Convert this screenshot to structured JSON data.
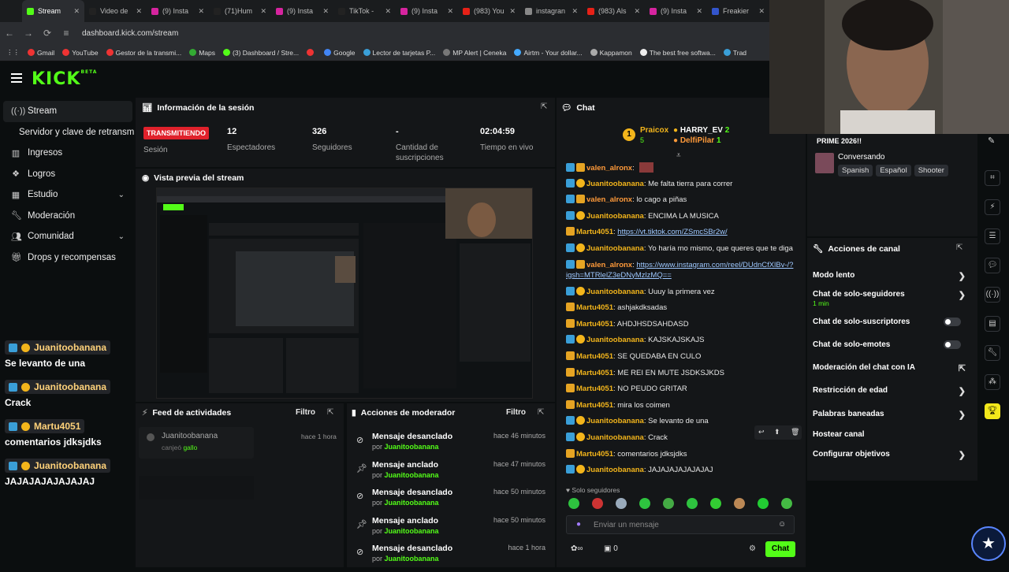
{
  "browser": {
    "tabs": [
      {
        "label": "Stream",
        "color": "#53fc18",
        "active": true
      },
      {
        "label": "Video de",
        "color": "#222"
      },
      {
        "label": "(9) Insta",
        "color": "#d6249f"
      },
      {
        "label": "(71)Hum",
        "color": "#222"
      },
      {
        "label": "(9) Insta",
        "color": "#d6249f"
      },
      {
        "label": "TikTok -",
        "color": "#222"
      },
      {
        "label": "(9) Insta",
        "color": "#d6249f"
      },
      {
        "label": "(983) You",
        "color": "#e62117"
      },
      {
        "label": "instagran",
        "color": "#888"
      },
      {
        "label": "(983) Als",
        "color": "#e62117"
      },
      {
        "label": "(9) Insta",
        "color": "#d6249f"
      },
      {
        "label": "Freakier",
        "color": "#3355cc"
      }
    ],
    "url": "dashboard.kick.com/stream",
    "bookmarks": [
      {
        "label": "Gmail",
        "color": "#e33"
      },
      {
        "label": "YouTube",
        "color": "#e33"
      },
      {
        "label": "Gestor de la transmi...",
        "color": "#e33"
      },
      {
        "label": "Maps",
        "color": "#3a3"
      },
      {
        "label": "(3) Dashboard / Stre...",
        "color": "#53fc18"
      },
      {
        "label": "",
        "color": "#e33"
      },
      {
        "label": "Google",
        "color": "#4285f4"
      },
      {
        "label": "Lector de tarjetas P...",
        "color": "#3a9fd8"
      },
      {
        "label": "MP Alert | Ceneka",
        "color": "#777"
      },
      {
        "label": "Airtm - Your dollar...",
        "color": "#4af"
      },
      {
        "label": "Kappamon",
        "color": "#aaa"
      },
      {
        "label": "The best free softwa...",
        "color": "#eee"
      },
      {
        "label": "Trad",
        "color": "#3a9fd8"
      }
    ]
  },
  "kick": {
    "logo": "KICK",
    "beta": "BETA"
  },
  "sidebar": {
    "items": [
      {
        "label": "Stream",
        "icon": "stream-icon",
        "sel": true
      },
      {
        "label": "Servidor y clave de retransm",
        "sub": true
      },
      {
        "label": "Ingresos",
        "icon": "chart-icon"
      },
      {
        "label": "Logros",
        "icon": "award-icon"
      },
      {
        "label": "Estudio",
        "icon": "layout-icon",
        "chev": true
      },
      {
        "label": "Moderación",
        "icon": "wrench-icon"
      },
      {
        "label": "Comunidad",
        "icon": "people-icon",
        "chev": true
      },
      {
        "label": "Drops y recompensas",
        "icon": "gift-icon"
      }
    ]
  },
  "overlay": [
    {
      "name": "Juanitoobanana",
      "msg": "Se levanto de una"
    },
    {
      "name": "Juanitoobanana",
      "msg": "Crack"
    },
    {
      "name": "Martu4051",
      "msg": "comentarios jdksjdks"
    },
    {
      "name": "Juanitoobanana",
      "msg": "JAJAJAJAJAJAJAJ"
    }
  ],
  "session": {
    "title": "Información de la sesión",
    "status": "TRANSMITIENDO",
    "status_label": "Sesión",
    "stats": [
      {
        "value": "12",
        "label": "Espectadores"
      },
      {
        "value": "326",
        "label": "Seguidores"
      },
      {
        "value": "-",
        "label": "Cantidad de suscripciones"
      },
      {
        "value": "02:04:59",
        "label": "Tiempo en vivo"
      }
    ]
  },
  "preview": {
    "title": "Vista previa del stream"
  },
  "activity": {
    "title": "Feed de actividades",
    "filter": "Filtro",
    "user": "Juanitoobanana",
    "action": "canjeó",
    "item": "gallo",
    "time": "hace 1 hora"
  },
  "modactions": {
    "title": "Acciones de moderador",
    "filter": "Filtro",
    "prefix": "por",
    "rows": [
      {
        "title": "Mensaje desanclado",
        "by": "Juanitoobanana",
        "time": "hace 46 minutos",
        "icon": "unpin-icon"
      },
      {
        "title": "Mensaje anclado",
        "by": "Juanitoobanana",
        "time": "hace 47 minutos",
        "icon": "pin-icon"
      },
      {
        "title": "Mensaje desanclado",
        "by": "Juanitoobanana",
        "time": "hace 50 minutos",
        "icon": "unpin-icon"
      },
      {
        "title": "Mensaje anclado",
        "by": "Juanitoobanana",
        "time": "hace 50 minutos",
        "icon": "pin-icon"
      },
      {
        "title": "Mensaje desanclado",
        "by": "Juanitoobanana",
        "time": "hace 1 hora",
        "icon": "unpin-icon"
      }
    ]
  },
  "chat": {
    "title": "Chat",
    "leaderboard": {
      "gift_count": "5",
      "user1": "Praicox",
      "user2": "HARRY_EV",
      "user2_count": "2",
      "user3": "DelfiPilar",
      "user3_count": "1"
    },
    "messages": [
      {
        "user": "valen_alronx",
        "text": "",
        "color": "#ff9a3a",
        "badges": [
          "b-blue",
          "b-crown"
        ],
        "emote": true
      },
      {
        "user": "Juanitoobanana",
        "text": "Me falta tierra para correr",
        "color": "#f3b51b",
        "badges": [
          "b-blue",
          "b-gold"
        ]
      },
      {
        "user": "valen_alronx",
        "text": "lo cago a piñas",
        "color": "#ff9a3a",
        "badges": [
          "b-blue",
          "b-crown"
        ]
      },
      {
        "user": "Juanitoobanana",
        "text": "ENCIMA LA MUSICA",
        "color": "#f3b51b",
        "badges": [
          "b-blue",
          "b-gold"
        ]
      },
      {
        "user": "Martu4051",
        "text": "",
        "link": "https://vt.tiktok.com/ZSmcSBr2w/",
        "color": "#f3b51b",
        "badges": [
          "b-crown"
        ]
      },
      {
        "user": "Juanitoobanana",
        "text": "Yo haría mo mismo, que queres que te diga",
        "color": "#f3b51b",
        "badges": [
          "b-blue",
          "b-gold"
        ]
      },
      {
        "user": "valen_alronx",
        "text": "",
        "link": "https://www.instagram.com/reel/DUdnCfXlBv-/?igsh=MTRlelZ3eDNyMzlzMQ==",
        "color": "#ff9a3a",
        "badges": [
          "b-blue",
          "b-crown"
        ],
        "two": true
      },
      {
        "user": "Juanitoobanana",
        "text": "Uuuy la primera vez",
        "color": "#f3b51b",
        "badges": [
          "b-blue",
          "b-gold"
        ]
      },
      {
        "user": "Martu4051",
        "text": "ashjakdksadas",
        "color": "#f3b51b",
        "badges": [
          "b-crown"
        ]
      },
      {
        "user": "Martu4051",
        "text": "AHDJHSDSAHDASD",
        "color": "#f3b51b",
        "badges": [
          "b-crown"
        ]
      },
      {
        "user": "Juanitoobanana",
        "text": "KAJSKAJSKAJS",
        "color": "#f3b51b",
        "badges": [
          "b-blue",
          "b-gold"
        ]
      },
      {
        "user": "Martu4051",
        "text": "SE QUEDABA EN CULO",
        "color": "#f3b51b",
        "badges": [
          "b-crown"
        ]
      },
      {
        "user": "Martu4051",
        "text": "ME REI EN MUTE JSDKSJKDS",
        "color": "#f3b51b",
        "badges": [
          "b-crown"
        ]
      },
      {
        "user": "Martu4051",
        "text": "NO PEUDO GRITAR",
        "color": "#f3b51b",
        "badges": [
          "b-crown"
        ]
      },
      {
        "user": "Martu4051",
        "text": "mira los coimen",
        "color": "#f3b51b",
        "badges": [
          "b-crown"
        ]
      },
      {
        "user": "Juanitoobanana",
        "text": "Se levanto de una",
        "color": "#f3b51b",
        "badges": [
          "b-blue",
          "b-gold"
        ]
      },
      {
        "user": "Juanitoobanana",
        "text": "Crack",
        "color": "#f3b51b",
        "badges": [
          "b-blue",
          "b-gold"
        ]
      },
      {
        "user": "Martu4051",
        "text": "comentarios jdksjdks",
        "color": "#f3b51b",
        "badges": [
          "b-crown"
        ]
      },
      {
        "user": "Juanitoobanana",
        "text": "JAJAJAJAJAJAJAJ",
        "color": "#f3b51b",
        "badges": [
          "b-blue",
          "b-gold"
        ]
      }
    ],
    "followers_only": "Solo seguidores",
    "placeholder": "Enviar un mensaje",
    "points": "0",
    "send": "Chat"
  },
  "streaminfo": {
    "title_partial": "PRIME 2026!!",
    "category": "Conversando",
    "tags": [
      "Spanish",
      "Español",
      "Shooter"
    ]
  },
  "channel_actions": {
    "title": "Acciones de canal",
    "items": [
      {
        "label": "Modo lento",
        "control": "chev"
      },
      {
        "label": "Chat de solo-seguidores",
        "sub": "1 min",
        "control": "chev"
      },
      {
        "label": "Chat de solo-suscriptores",
        "control": "toggle"
      },
      {
        "label": "Chat de solo-emotes",
        "control": "toggle"
      },
      {
        "label": "Moderación del chat con IA",
        "control": "ext"
      },
      {
        "label": "Restricción de edad",
        "control": "chev"
      },
      {
        "label": "Palabras baneadas",
        "control": "chev"
      },
      {
        "label": "Hostear canal",
        "control": "none"
      },
      {
        "label": "Configurar objetivos",
        "control": "chev"
      }
    ]
  },
  "colors": {
    "accent": "#53fc18",
    "live": "#e0212b",
    "panel": "#141618",
    "bg": "#0b0e0f"
  }
}
